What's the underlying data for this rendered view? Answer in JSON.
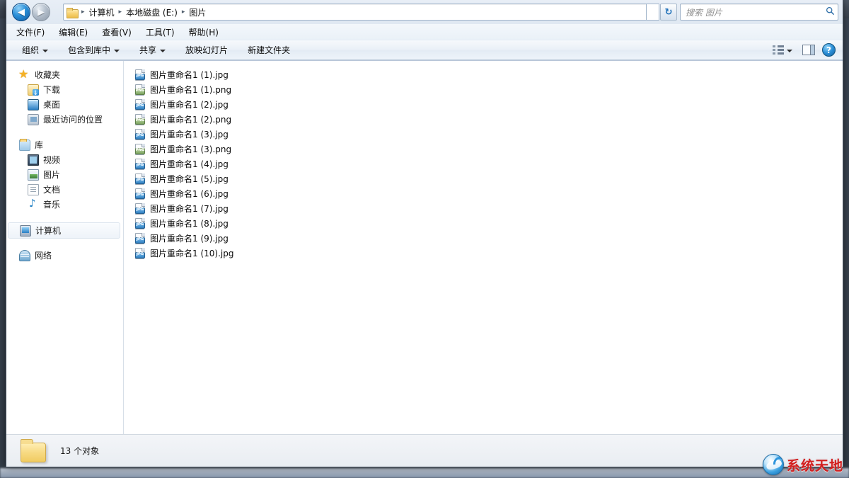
{
  "window": {
    "caption_buttons": [
      {
        "name": "minimize",
        "glyph": "minimize-glyph"
      },
      {
        "name": "restore",
        "glyph": "restore-glyph"
      },
      {
        "name": "close",
        "glyph": "✕"
      }
    ]
  },
  "address_bar": {
    "back_arrow": "◀",
    "forward_arrow": "▶",
    "breadcrumb": [
      {
        "label": "计算机"
      },
      {
        "label": "本地磁盘 (E:)"
      },
      {
        "label": "图片"
      }
    ],
    "separator": "▸",
    "refresh_glyph": "↻",
    "search": {
      "placeholder": "搜索 图片",
      "icon": "🔍"
    }
  },
  "menu_bar": {
    "items": [
      {
        "label": "文件(F)"
      },
      {
        "label": "编辑(E)"
      },
      {
        "label": "查看(V)"
      },
      {
        "label": "工具(T)"
      },
      {
        "label": "帮助(H)"
      }
    ]
  },
  "command_bar": {
    "items": [
      {
        "label": "组织",
        "has_caret": true
      },
      {
        "label": "包含到库中",
        "has_caret": true
      },
      {
        "label": "共享",
        "has_caret": true
      },
      {
        "label": "放映幻灯片",
        "has_caret": false
      },
      {
        "label": "新建文件夹",
        "has_caret": false
      }
    ],
    "help_glyph": "?"
  },
  "nav_pane": {
    "groups": [
      {
        "root": {
          "label": "收藏夹",
          "icon": "star-icon"
        },
        "children": [
          {
            "label": "下载",
            "icon": "download-icon"
          },
          {
            "label": "桌面",
            "icon": "desktop-icon"
          },
          {
            "label": "最近访问的位置",
            "icon": "recent-places-icon"
          }
        ]
      },
      {
        "root": {
          "label": "库",
          "icon": "library-icon"
        },
        "children": [
          {
            "label": "视频",
            "icon": "video-icon"
          },
          {
            "label": "图片",
            "icon": "pictures-icon"
          },
          {
            "label": "文档",
            "icon": "documents-icon"
          },
          {
            "label": "音乐",
            "icon": "music-icon"
          }
        ]
      },
      {
        "root": {
          "label": "计算机",
          "icon": "computer-icon",
          "selected": true
        },
        "children": []
      },
      {
        "root": {
          "label": "网络",
          "icon": "network-icon"
        },
        "children": []
      }
    ]
  },
  "file_list": {
    "files": [
      {
        "name": "图片重命名1 (1).jpg",
        "type": "JPG"
      },
      {
        "name": "图片重命名1 (1).png",
        "type": "PNG"
      },
      {
        "name": "图片重命名1 (2).jpg",
        "type": "JPG"
      },
      {
        "name": "图片重命名1 (2).png",
        "type": "PNG"
      },
      {
        "name": "图片重命名1 (3).jpg",
        "type": "JPG"
      },
      {
        "name": "图片重命名1 (3).png",
        "type": "PNG"
      },
      {
        "name": "图片重命名1 (4).jpg",
        "type": "JPG"
      },
      {
        "name": "图片重命名1 (5).jpg",
        "type": "JPG"
      },
      {
        "name": "图片重命名1 (6).jpg",
        "type": "JPG"
      },
      {
        "name": "图片重命名1 (7).jpg",
        "type": "JPG"
      },
      {
        "name": "图片重命名1 (8).jpg",
        "type": "JPG"
      },
      {
        "name": "图片重命名1 (9).jpg",
        "type": "JPG"
      },
      {
        "name": "图片重命名1 (10).jpg",
        "type": "JPG"
      }
    ]
  },
  "status_bar": {
    "text": "13 个对象"
  },
  "watermark": {
    "text": "系统天地"
  },
  "colors": {
    "accent_blue": "#2b8ed6",
    "close_red": "#c93a33",
    "jpg_badge": "#2f7fc0",
    "png_badge": "#7ba35f",
    "watermark_red": "#d21e1e",
    "folder_yellow": "#f0cb61"
  }
}
